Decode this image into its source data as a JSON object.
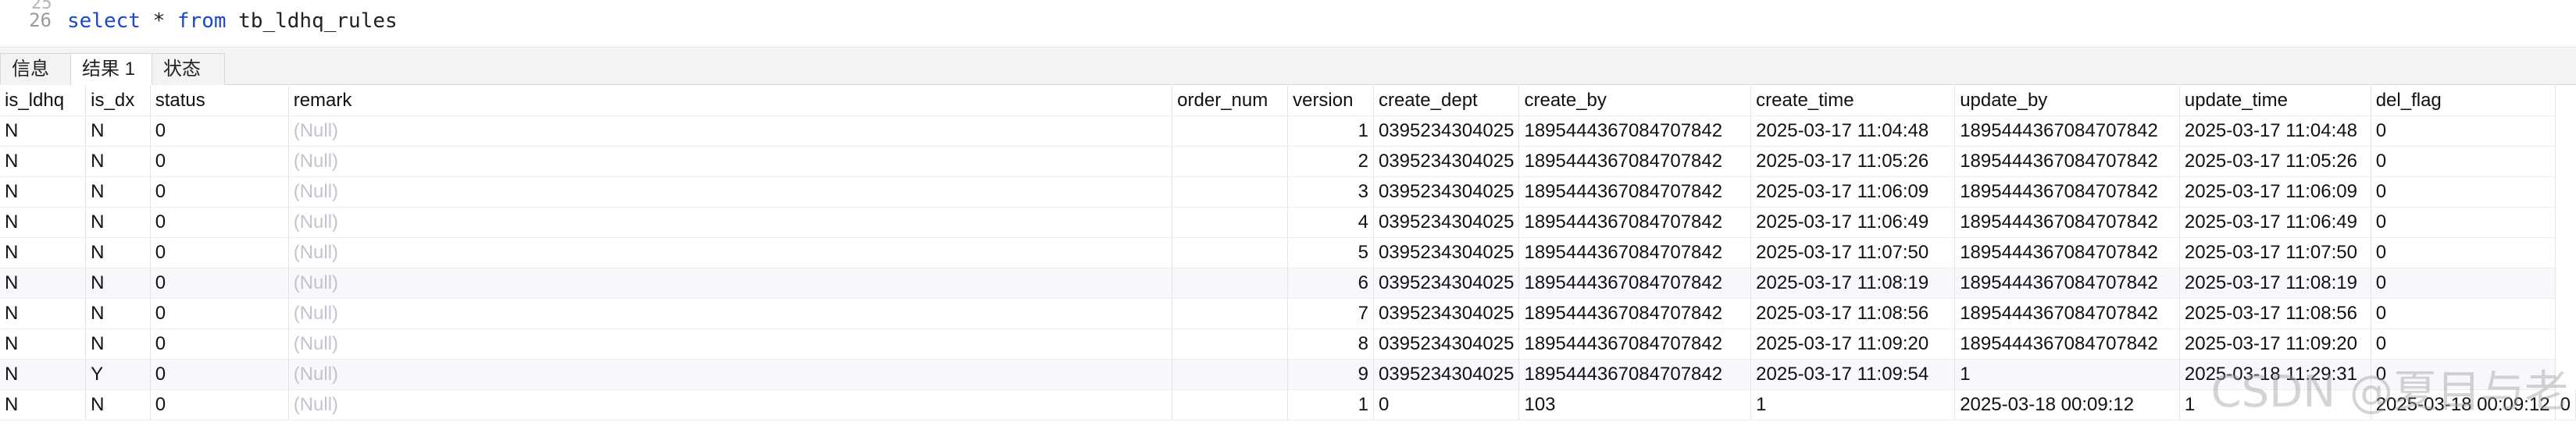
{
  "editor": {
    "prev_line_label": "25",
    "line_number": "26",
    "code": {
      "kw_select": "select",
      "star": " * ",
      "kw_from": "from",
      "table": " tb_ldhq_rules"
    }
  },
  "tabs": [
    {
      "label": "信息",
      "active": false
    },
    {
      "label": "结果 1",
      "active": true
    },
    {
      "label": "状态",
      "active": false
    }
  ],
  "columns": [
    "is_ldhq",
    "is_dx",
    "status",
    "remark",
    "order_num",
    "version",
    "create_dept",
    "create_by",
    "create_time",
    "update_by",
    "update_time",
    "del_flag"
  ],
  "rows": [
    [
      "N",
      "N",
      "0",
      "(Null)",
      "",
      "1",
      "0395234304025",
      "1895444367084707842",
      "2025-03-17 11:04:48",
      "1895444367084707842",
      "2025-03-17 11:04:48",
      "0"
    ],
    [
      "N",
      "N",
      "0",
      "(Null)",
      "",
      "2",
      "0395234304025",
      "1895444367084707842",
      "2025-03-17 11:05:26",
      "1895444367084707842",
      "2025-03-17 11:05:26",
      "0"
    ],
    [
      "N",
      "N",
      "0",
      "(Null)",
      "",
      "3",
      "0395234304025",
      "1895444367084707842",
      "2025-03-17 11:06:09",
      "1895444367084707842",
      "2025-03-17 11:06:09",
      "0"
    ],
    [
      "N",
      "N",
      "0",
      "(Null)",
      "",
      "4",
      "0395234304025",
      "1895444367084707842",
      "2025-03-17 11:06:49",
      "1895444367084707842",
      "2025-03-17 11:06:49",
      "0"
    ],
    [
      "N",
      "N",
      "0",
      "(Null)",
      "",
      "5",
      "0395234304025",
      "1895444367084707842",
      "2025-03-17 11:07:50",
      "1895444367084707842",
      "2025-03-17 11:07:50",
      "0"
    ],
    [
      "N",
      "N",
      "0",
      "(Null)",
      "",
      "6",
      "0395234304025",
      "1895444367084707842",
      "2025-03-17 11:08:19",
      "1895444367084707842",
      "2025-03-17 11:08:19",
      "0"
    ],
    [
      "N",
      "N",
      "0",
      "(Null)",
      "",
      "7",
      "0395234304025",
      "1895444367084707842",
      "2025-03-17 11:08:56",
      "1895444367084707842",
      "2025-03-17 11:08:56",
      "0"
    ],
    [
      "N",
      "N",
      "0",
      "(Null)",
      "",
      "8",
      "0395234304025",
      "1895444367084707842",
      "2025-03-17 11:09:20",
      "1895444367084707842",
      "2025-03-17 11:09:20",
      "0"
    ],
    [
      "N",
      "Y",
      "0",
      "(Null)",
      "",
      "9",
      "0395234304025",
      "1895444367084707842",
      "2025-03-17 11:09:54",
      "1",
      "2025-03-18 11:29:31",
      "0"
    ],
    [
      "N",
      "N",
      "0",
      "(Null)",
      "",
      "1",
      "0",
      "103",
      "1",
      "2025-03-18 00:09:12",
      "1",
      "2025-03-18 00:09:12",
      "0"
    ]
  ],
  "watermark": "CSDN @夏目与老"
}
